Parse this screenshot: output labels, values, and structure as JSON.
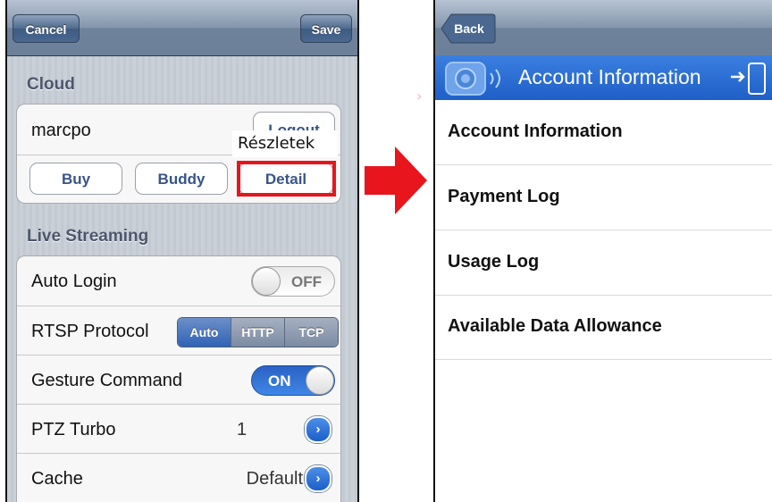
{
  "left_screen": {
    "nav": {
      "cancel": "Cancel",
      "save": "Save"
    },
    "cloud": {
      "section": "Cloud",
      "username": "marcpo",
      "logout": "Logout",
      "annotation": "Részletek",
      "buttons": {
        "buy": "Buy",
        "buddy": "Buddy",
        "detail": "Detail"
      }
    },
    "live": {
      "section": "Live Streaming",
      "auto_login": {
        "label": "Auto Login",
        "state": "OFF"
      },
      "rtsp": {
        "label": "RTSP Protocol",
        "options": [
          "Auto",
          "HTTP",
          "TCP"
        ],
        "selected": "Auto"
      },
      "gesture": {
        "label": "Gesture Command",
        "state": "ON"
      },
      "ptz": {
        "label": "PTZ Turbo",
        "value": "1"
      },
      "cache": {
        "label": "Cache",
        "value": "Default"
      }
    }
  },
  "right_screen": {
    "nav": {
      "back": "Back",
      "title": "Account Information"
    },
    "items": [
      "Account Information",
      "Payment Log",
      "Usage Log",
      "Available Data Allowance"
    ]
  },
  "colors": {
    "highlight": "#e8151c",
    "arrow": "#e8151c",
    "switch_on": "#1f6fd4",
    "title_bar": "#2b6cd0"
  }
}
